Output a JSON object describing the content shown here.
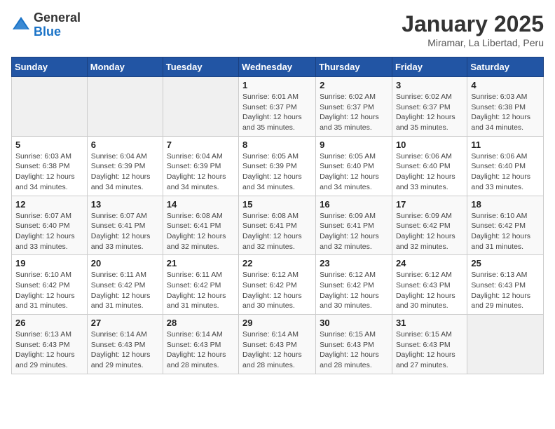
{
  "logo": {
    "general": "General",
    "blue": "Blue"
  },
  "title": "January 2025",
  "subtitle": "Miramar, La Libertad, Peru",
  "days_of_week": [
    "Sunday",
    "Monday",
    "Tuesday",
    "Wednesday",
    "Thursday",
    "Friday",
    "Saturday"
  ],
  "weeks": [
    [
      {
        "day": "",
        "info": ""
      },
      {
        "day": "",
        "info": ""
      },
      {
        "day": "",
        "info": ""
      },
      {
        "day": "1",
        "info": "Sunrise: 6:01 AM\nSunset: 6:37 PM\nDaylight: 12 hours\nand 35 minutes."
      },
      {
        "day": "2",
        "info": "Sunrise: 6:02 AM\nSunset: 6:37 PM\nDaylight: 12 hours\nand 35 minutes."
      },
      {
        "day": "3",
        "info": "Sunrise: 6:02 AM\nSunset: 6:37 PM\nDaylight: 12 hours\nand 35 minutes."
      },
      {
        "day": "4",
        "info": "Sunrise: 6:03 AM\nSunset: 6:38 PM\nDaylight: 12 hours\nand 34 minutes."
      }
    ],
    [
      {
        "day": "5",
        "info": "Sunrise: 6:03 AM\nSunset: 6:38 PM\nDaylight: 12 hours\nand 34 minutes."
      },
      {
        "day": "6",
        "info": "Sunrise: 6:04 AM\nSunset: 6:39 PM\nDaylight: 12 hours\nand 34 minutes."
      },
      {
        "day": "7",
        "info": "Sunrise: 6:04 AM\nSunset: 6:39 PM\nDaylight: 12 hours\nand 34 minutes."
      },
      {
        "day": "8",
        "info": "Sunrise: 6:05 AM\nSunset: 6:39 PM\nDaylight: 12 hours\nand 34 minutes."
      },
      {
        "day": "9",
        "info": "Sunrise: 6:05 AM\nSunset: 6:40 PM\nDaylight: 12 hours\nand 34 minutes."
      },
      {
        "day": "10",
        "info": "Sunrise: 6:06 AM\nSunset: 6:40 PM\nDaylight: 12 hours\nand 33 minutes."
      },
      {
        "day": "11",
        "info": "Sunrise: 6:06 AM\nSunset: 6:40 PM\nDaylight: 12 hours\nand 33 minutes."
      }
    ],
    [
      {
        "day": "12",
        "info": "Sunrise: 6:07 AM\nSunset: 6:40 PM\nDaylight: 12 hours\nand 33 minutes."
      },
      {
        "day": "13",
        "info": "Sunrise: 6:07 AM\nSunset: 6:41 PM\nDaylight: 12 hours\nand 33 minutes."
      },
      {
        "day": "14",
        "info": "Sunrise: 6:08 AM\nSunset: 6:41 PM\nDaylight: 12 hours\nand 32 minutes."
      },
      {
        "day": "15",
        "info": "Sunrise: 6:08 AM\nSunset: 6:41 PM\nDaylight: 12 hours\nand 32 minutes."
      },
      {
        "day": "16",
        "info": "Sunrise: 6:09 AM\nSunset: 6:41 PM\nDaylight: 12 hours\nand 32 minutes."
      },
      {
        "day": "17",
        "info": "Sunrise: 6:09 AM\nSunset: 6:42 PM\nDaylight: 12 hours\nand 32 minutes."
      },
      {
        "day": "18",
        "info": "Sunrise: 6:10 AM\nSunset: 6:42 PM\nDaylight: 12 hours\nand 31 minutes."
      }
    ],
    [
      {
        "day": "19",
        "info": "Sunrise: 6:10 AM\nSunset: 6:42 PM\nDaylight: 12 hours\nand 31 minutes."
      },
      {
        "day": "20",
        "info": "Sunrise: 6:11 AM\nSunset: 6:42 PM\nDaylight: 12 hours\nand 31 minutes."
      },
      {
        "day": "21",
        "info": "Sunrise: 6:11 AM\nSunset: 6:42 PM\nDaylight: 12 hours\nand 31 minutes."
      },
      {
        "day": "22",
        "info": "Sunrise: 6:12 AM\nSunset: 6:42 PM\nDaylight: 12 hours\nand 30 minutes."
      },
      {
        "day": "23",
        "info": "Sunrise: 6:12 AM\nSunset: 6:42 PM\nDaylight: 12 hours\nand 30 minutes."
      },
      {
        "day": "24",
        "info": "Sunrise: 6:12 AM\nSunset: 6:43 PM\nDaylight: 12 hours\nand 30 minutes."
      },
      {
        "day": "25",
        "info": "Sunrise: 6:13 AM\nSunset: 6:43 PM\nDaylight: 12 hours\nand 29 minutes."
      }
    ],
    [
      {
        "day": "26",
        "info": "Sunrise: 6:13 AM\nSunset: 6:43 PM\nDaylight: 12 hours\nand 29 minutes."
      },
      {
        "day": "27",
        "info": "Sunrise: 6:14 AM\nSunset: 6:43 PM\nDaylight: 12 hours\nand 29 minutes."
      },
      {
        "day": "28",
        "info": "Sunrise: 6:14 AM\nSunset: 6:43 PM\nDaylight: 12 hours\nand 28 minutes."
      },
      {
        "day": "29",
        "info": "Sunrise: 6:14 AM\nSunset: 6:43 PM\nDaylight: 12 hours\nand 28 minutes."
      },
      {
        "day": "30",
        "info": "Sunrise: 6:15 AM\nSunset: 6:43 PM\nDaylight: 12 hours\nand 28 minutes."
      },
      {
        "day": "31",
        "info": "Sunrise: 6:15 AM\nSunset: 6:43 PM\nDaylight: 12 hours\nand 27 minutes."
      },
      {
        "day": "",
        "info": ""
      }
    ]
  ]
}
